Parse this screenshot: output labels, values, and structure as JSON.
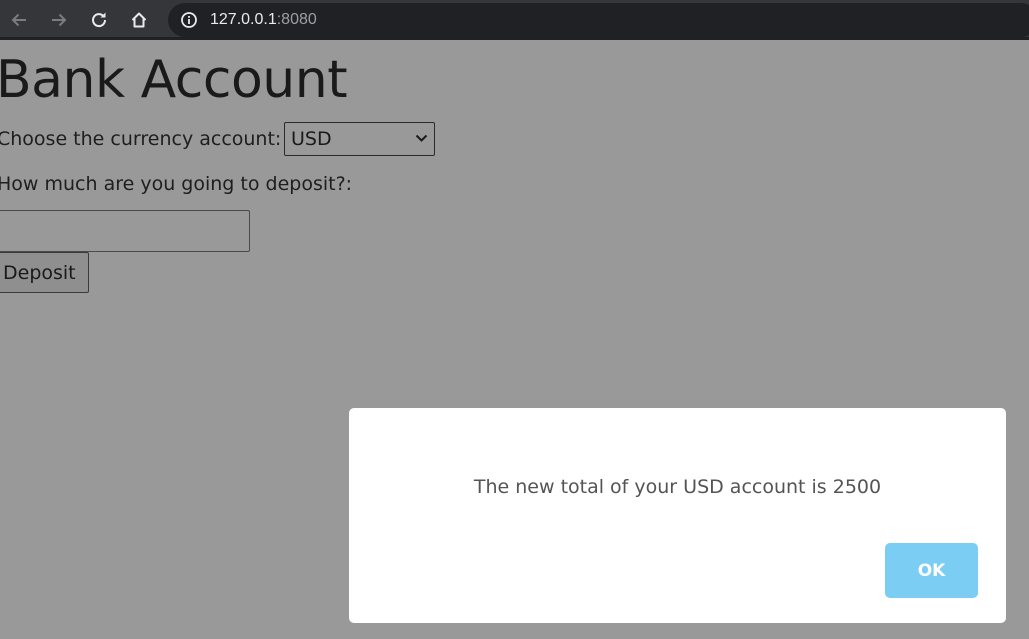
{
  "browser": {
    "url_host": "127.0.0.1",
    "url_port": ":8080",
    "icons": {
      "back": "arrow-left-icon",
      "forward": "arrow-right-icon",
      "reload": "reload-icon",
      "home": "home-icon",
      "site_info": "info-icon"
    }
  },
  "page": {
    "title": "Bank Account",
    "currency_label": "Choose the currency account:",
    "currency_selected": "USD",
    "deposit_label": "How much are you going to deposit?:",
    "amount_value": "",
    "amount_placeholder": "",
    "deposit_button": "Deposit"
  },
  "modal": {
    "message": "The new total of your USD account is 2500",
    "ok_label": "OK",
    "ok_color": "#7ccdf4"
  },
  "colors": {
    "overlay_background": "#999999",
    "browser_bar": "#35363a",
    "omnibox": "#202124"
  }
}
